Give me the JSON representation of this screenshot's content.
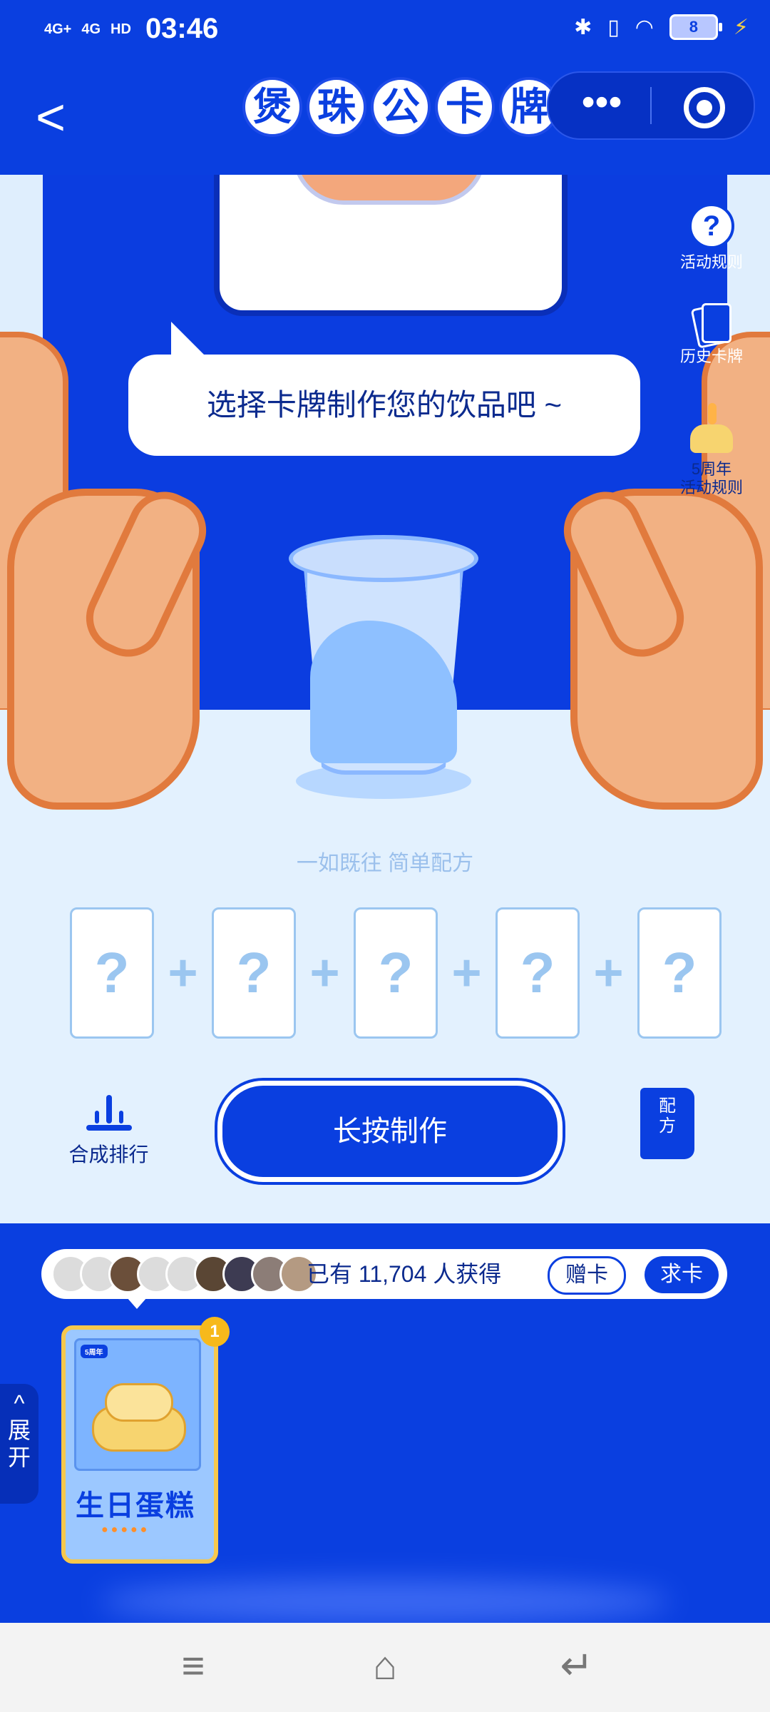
{
  "status_bar": {
    "signal_1": "4G+",
    "signal_2": "4G",
    "hd": "HD",
    "time": "03:46",
    "battery": "8"
  },
  "header": {
    "title_chars": [
      "煲",
      "珠",
      "公",
      "卡",
      "牌"
    ],
    "more_label": "•••"
  },
  "side_menu": {
    "rules_label": "活动规则",
    "history_label": "历史卡牌",
    "anniv_line1": "5周年",
    "anniv_line2": "活动规则"
  },
  "scene": {
    "bubble_text": "选择卡牌制作您的饮品吧 ~",
    "slogan": "一如既往 简单配方",
    "slot_symbol": "?",
    "plus_symbol": "+"
  },
  "actions": {
    "rank_label": "合成排行",
    "make_button": "长按制作",
    "recipe_label_1": "配",
    "recipe_label_2": "方"
  },
  "obtained_bar": {
    "text": "已有 11,704 人获得",
    "gift_button": "赠卡",
    "ask_button": "求卡"
  },
  "card": {
    "tag": "5周年",
    "name": "生日蛋糕",
    "count": "1",
    "drops": "●●●●●"
  },
  "expand": {
    "arrow": "^",
    "line1": "展",
    "line2": "开"
  },
  "colors": {
    "brand_blue": "#0a3fe0",
    "dark_text": "#0b2a8e",
    "light_bg": "#e3f1fe",
    "gold": "#f7c84c"
  }
}
